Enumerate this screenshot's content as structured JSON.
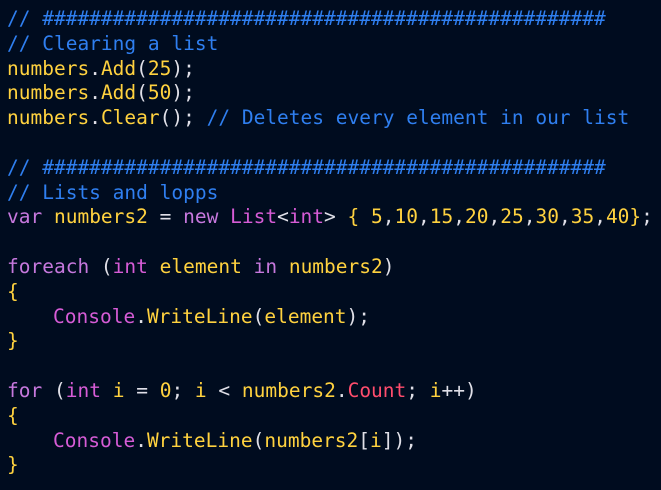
{
  "editor": {
    "colors": {
      "background": "#000c1f",
      "comment": "#2f7ff0",
      "identifier": "#ffd23f",
      "keyword": "#c678dd",
      "type": "#d65cd6",
      "property": "#ff4d6d",
      "punctuation": "#e0e0e8"
    },
    "lines": [
      {
        "tokens": [
          {
            "c": "t-comment",
            "t": "// ################################################"
          }
        ]
      },
      {
        "tokens": [
          {
            "c": "t-comment",
            "t": "// Clearing a list"
          }
        ]
      },
      {
        "tokens": [
          {
            "c": "t-ident",
            "t": "numbers"
          },
          {
            "c": "t-plain",
            "t": "."
          },
          {
            "c": "t-call",
            "t": "Add"
          },
          {
            "c": "t-plain",
            "t": "("
          },
          {
            "c": "t-num",
            "t": "25"
          },
          {
            "c": "t-plain",
            "t": ");"
          }
        ]
      },
      {
        "tokens": [
          {
            "c": "t-ident",
            "t": "numbers"
          },
          {
            "c": "t-plain",
            "t": "."
          },
          {
            "c": "t-call",
            "t": "Add"
          },
          {
            "c": "t-plain",
            "t": "("
          },
          {
            "c": "t-num",
            "t": "50"
          },
          {
            "c": "t-plain",
            "t": ");"
          }
        ]
      },
      {
        "tokens": [
          {
            "c": "t-ident",
            "t": "numbers"
          },
          {
            "c": "t-plain",
            "t": "."
          },
          {
            "c": "t-call",
            "t": "Clear"
          },
          {
            "c": "t-plain",
            "t": "(); "
          },
          {
            "c": "t-comment",
            "t": "// Deletes every element in our list"
          }
        ]
      },
      {
        "tokens": []
      },
      {
        "tokens": [
          {
            "c": "t-comment",
            "t": "// ################################################"
          }
        ]
      },
      {
        "tokens": [
          {
            "c": "t-comment",
            "t": "// Lists and lopps"
          }
        ]
      },
      {
        "tokens": [
          {
            "c": "t-kw",
            "t": "var "
          },
          {
            "c": "t-ident",
            "t": "numbers2"
          },
          {
            "c": "t-plain",
            "t": " = "
          },
          {
            "c": "t-kw",
            "t": "new "
          },
          {
            "c": "t-class",
            "t": "List"
          },
          {
            "c": "t-plain",
            "t": "<"
          },
          {
            "c": "t-type",
            "t": "int"
          },
          {
            "c": "t-plain",
            "t": "> "
          },
          {
            "c": "t-brace",
            "t": "{"
          },
          {
            "c": "t-plain",
            "t": " "
          },
          {
            "c": "t-num",
            "t": "5"
          },
          {
            "c": "t-plain",
            "t": ","
          },
          {
            "c": "t-num",
            "t": "10"
          },
          {
            "c": "t-plain",
            "t": ","
          },
          {
            "c": "t-num",
            "t": "15"
          },
          {
            "c": "t-plain",
            "t": ","
          },
          {
            "c": "t-num",
            "t": "20"
          },
          {
            "c": "t-plain",
            "t": ","
          },
          {
            "c": "t-num",
            "t": "25"
          },
          {
            "c": "t-plain",
            "t": ","
          },
          {
            "c": "t-num",
            "t": "30"
          },
          {
            "c": "t-plain",
            "t": ","
          },
          {
            "c": "t-num",
            "t": "35"
          },
          {
            "c": "t-plain",
            "t": ","
          },
          {
            "c": "t-num",
            "t": "40"
          },
          {
            "c": "t-brace",
            "t": "}"
          },
          {
            "c": "t-plain",
            "t": ";"
          }
        ]
      },
      {
        "tokens": []
      },
      {
        "tokens": [
          {
            "c": "t-kw",
            "t": "foreach"
          },
          {
            "c": "t-plain",
            "t": " ("
          },
          {
            "c": "t-type",
            "t": "int"
          },
          {
            "c": "t-plain",
            "t": " "
          },
          {
            "c": "t-ident",
            "t": "element"
          },
          {
            "c": "t-plain",
            "t": " "
          },
          {
            "c": "t-kw",
            "t": "in"
          },
          {
            "c": "t-plain",
            "t": " "
          },
          {
            "c": "t-ident",
            "t": "numbers2"
          },
          {
            "c": "t-plain",
            "t": ")"
          }
        ]
      },
      {
        "tokens": [
          {
            "c": "t-brace",
            "t": "{"
          }
        ]
      },
      {
        "indent": true,
        "tokens": [
          {
            "c": "t-class",
            "t": "Console"
          },
          {
            "c": "t-plain",
            "t": "."
          },
          {
            "c": "t-call",
            "t": "WriteLine"
          },
          {
            "c": "t-plain",
            "t": "("
          },
          {
            "c": "t-ident",
            "t": "element"
          },
          {
            "c": "t-plain",
            "t": ");"
          }
        ]
      },
      {
        "tokens": [
          {
            "c": "t-brace",
            "t": "}"
          }
        ]
      },
      {
        "tokens": []
      },
      {
        "tokens": [
          {
            "c": "t-kw",
            "t": "for"
          },
          {
            "c": "t-plain",
            "t": " ("
          },
          {
            "c": "t-type",
            "t": "int"
          },
          {
            "c": "t-plain",
            "t": " "
          },
          {
            "c": "t-ident",
            "t": "i"
          },
          {
            "c": "t-plain",
            "t": " = "
          },
          {
            "c": "t-num",
            "t": "0"
          },
          {
            "c": "t-plain",
            "t": "; "
          },
          {
            "c": "t-ident",
            "t": "i"
          },
          {
            "c": "t-plain",
            "t": " < "
          },
          {
            "c": "t-ident",
            "t": "numbers2"
          },
          {
            "c": "t-plain",
            "t": "."
          },
          {
            "c": "t-prop",
            "t": "Count"
          },
          {
            "c": "t-plain",
            "t": "; "
          },
          {
            "c": "t-ident",
            "t": "i"
          },
          {
            "c": "t-plain",
            "t": "++)"
          }
        ]
      },
      {
        "tokens": [
          {
            "c": "t-brace",
            "t": "{"
          }
        ]
      },
      {
        "indent": true,
        "tokens": [
          {
            "c": "t-class",
            "t": "Console"
          },
          {
            "c": "t-plain",
            "t": "."
          },
          {
            "c": "t-call",
            "t": "WriteLine"
          },
          {
            "c": "t-plain",
            "t": "("
          },
          {
            "c": "t-ident",
            "t": "numbers2"
          },
          {
            "c": "t-plain",
            "t": "["
          },
          {
            "c": "t-ident",
            "t": "i"
          },
          {
            "c": "t-plain",
            "t": "]);"
          }
        ]
      },
      {
        "tokens": [
          {
            "c": "t-brace",
            "t": "}"
          }
        ]
      }
    ]
  }
}
